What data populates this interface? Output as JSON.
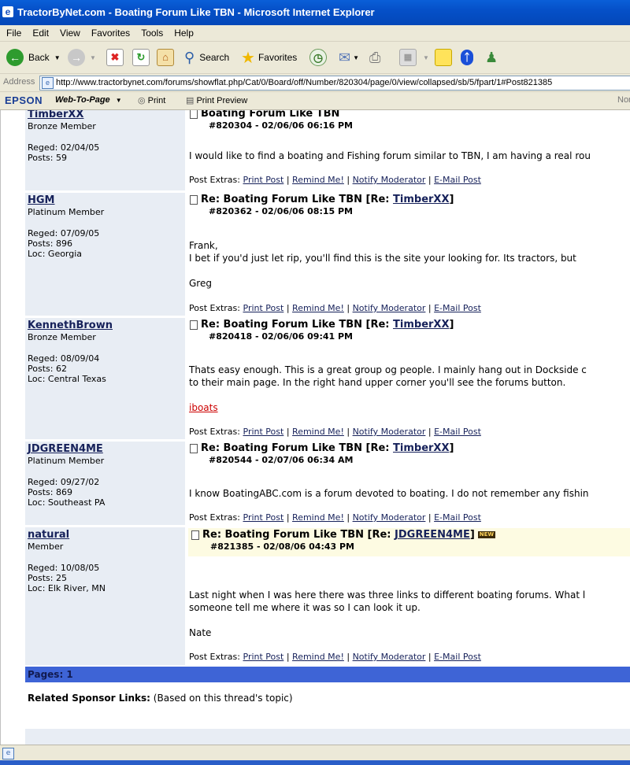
{
  "window": {
    "title": "TractorByNet.com - Boating Forum Like TBN - Microsoft Internet Explorer"
  },
  "menu": [
    "File",
    "Edit",
    "View",
    "Favorites",
    "Tools",
    "Help"
  ],
  "toolbar": {
    "back": "Back",
    "search": "Search",
    "favorites": "Favorites"
  },
  "address": {
    "label": "Address",
    "url": "http://www.tractorbynet.com/forums/showflat.php/Cat/0/Board/off/Number/820304/page/0/view/collapsed/sb/5/fpart/1#Post821385"
  },
  "epson": {
    "brand": "EPSON",
    "web_to_page": "Web-To-Page",
    "print": "Print",
    "print_preview": "Print Preview",
    "overflow": "Nor"
  },
  "post_extras": {
    "label": "Post Extras:",
    "print": "Print Post",
    "remind": "Remind Me!",
    "notify": "Notify Moderator",
    "email": "E-Mail Post",
    "sep": "|"
  },
  "posts": [
    {
      "author": "TimberXX",
      "rank": "Bronze Member",
      "reged": "Reged: 02/04/05",
      "posts": "Posts: 59",
      "loc": "",
      "subject": "Boating Forum Like TBN",
      "re_prefix": "",
      "re_user": "",
      "re_suffix": "",
      "number": "#820304 - 02/06/06 06:16 PM",
      "lines": [
        "I would like to find a boating and Fishing forum similar to TBN, I am having a real rou"
      ]
    },
    {
      "author": "HGM",
      "rank": "Platinum Member",
      "reged": "Reged: 07/09/05",
      "posts": "Posts: 896",
      "loc": "Loc: Georgia",
      "subject": "Re: Boating Forum Like TBN",
      "re_prefix": "[Re:",
      "re_user": "TimberXX",
      "re_suffix": "]",
      "number": "#820362 - 02/06/06 08:15 PM",
      "lines": [
        "Frank,",
        "I bet if you'd just let rip, you'll find this is the site your looking for. Its tractors, but",
        "Greg"
      ]
    },
    {
      "author": "KennethBrown",
      "rank": "Bronze Member",
      "reged": "Reged: 08/09/04",
      "posts": "Posts: 62",
      "loc": "Loc: Central Texas",
      "subject": "Re: Boating Forum Like TBN",
      "re_prefix": "[Re:",
      "re_user": "TimberXX",
      "re_suffix": "]",
      "number": "#820418 - 02/06/06 09:41 PM",
      "lines": [
        "Thats easy enough. This is a great group og people. I mainly hang out in Dockside c",
        "to their main page. In the right hand upper corner you'll see the forums button."
      ],
      "link": "iboats"
    },
    {
      "author": "JDGREEN4ME",
      "rank": "Platinum Member",
      "reged": "Reged: 09/27/02",
      "posts": "Posts: 869",
      "loc": "Loc: Southeast PA",
      "subject": "Re: Boating Forum Like TBN",
      "re_prefix": "[Re:",
      "re_user": "TimberXX",
      "re_suffix": "]",
      "number": "#820544 - 02/07/06 06:34 AM",
      "lines": [
        "I know BoatingABC.com is a forum devoted to boating. I do not remember any fishin"
      ]
    },
    {
      "author": "natural",
      "rank": "Member",
      "reged": "Reged: 10/08/05",
      "posts": "Posts: 25",
      "loc": "Loc: Elk River, MN",
      "subject": "Re: Boating Forum Like TBN",
      "re_prefix": "[Re:",
      "re_user": "JDGREEN4ME",
      "re_suffix": "]",
      "number": "#821385 - 02/08/06 04:43 PM",
      "badge": "NEW",
      "lines": [
        "Last night when I was here there was three links to different boating forums. What l",
        "someone tell me where it was so I can look it up.",
        "Nate"
      ]
    }
  ],
  "footer": {
    "pages": "Pages: 1",
    "related_bold": "Related Sponsor Links:",
    "related_rest": "(Based on this thread's topic)"
  }
}
